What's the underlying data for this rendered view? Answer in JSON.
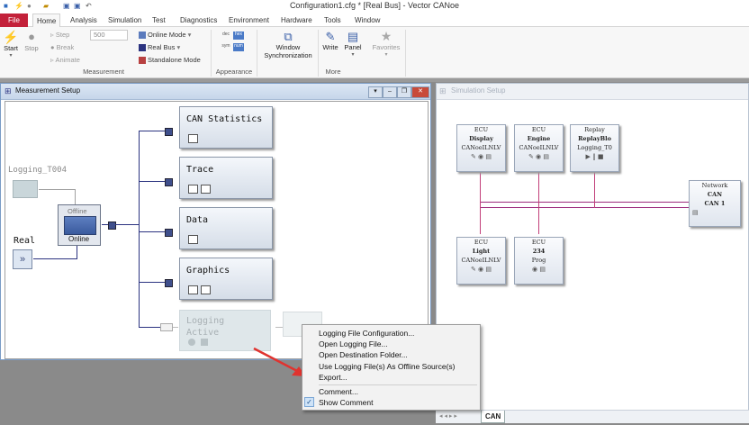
{
  "window": {
    "title": "Configuration1.cfg * [Real Bus] - Vector CANoe"
  },
  "menu": {
    "file": "File",
    "tabs": [
      "Home",
      "Analysis",
      "Simulation",
      "Test",
      "Diagnostics",
      "Environment",
      "Hardware",
      "Tools",
      "Window"
    ]
  },
  "ribbon": {
    "start": "Start",
    "stop": "Stop",
    "step": "Step",
    "step_value": "500",
    "break": "Break",
    "animate": "Animate",
    "online_mode": "Online Mode",
    "real_bus": "Real Bus",
    "standalone_mode": "Standalone Mode",
    "group_measurement": "Measurement",
    "dec": "dec",
    "hex": "hex",
    "sym": "sym",
    "num": "num",
    "group_appearance": "Appearance",
    "window_sync_1": "Window",
    "window_sync_2": "Synchronization",
    "write": "Write",
    "panel": "Panel",
    "favorites": "Favorites",
    "group_more": "More"
  },
  "measurement": {
    "title": "Measurement Setup",
    "logging_source": "Logging_T004",
    "real": "Real",
    "offline": "Offline",
    "online": "Online",
    "blocks": [
      "CAN Statistics",
      "Trace",
      "Data",
      "Graphics"
    ],
    "logging_block": "Logging",
    "logging_state": "Active"
  },
  "simulation": {
    "title": "Simulation Setup",
    "nodes": [
      {
        "type": "ECU",
        "name": "Display",
        "sub": "CANoeILNLV"
      },
      {
        "type": "ECU",
        "name": "Engine",
        "sub": "CANoeILNLV"
      },
      {
        "type": "Replay",
        "name": "ReplayBlo",
        "sub": "Logging_T0"
      },
      {
        "type": "ECU",
        "name": "Light",
        "sub": "CANoeILNLV"
      },
      {
        "type": "ECU",
        "name": "234",
        "sub": "Prog"
      }
    ],
    "network": {
      "line1": "Network",
      "line2": "CAN",
      "line3": "CAN 1"
    },
    "tab": "CAN"
  },
  "context_menu": {
    "items": [
      "Logging File Configuration...",
      "Open Logging File...",
      "Open Destination Folder...",
      "Use Logging File(s) As Offline Source(s)",
      "Export...",
      "Comment...",
      "Show Comment"
    ],
    "checked": "Show Comment"
  },
  "colors": {
    "accent": "#c3213a",
    "arrow": "#e0332f",
    "bus": "#2b3380"
  }
}
